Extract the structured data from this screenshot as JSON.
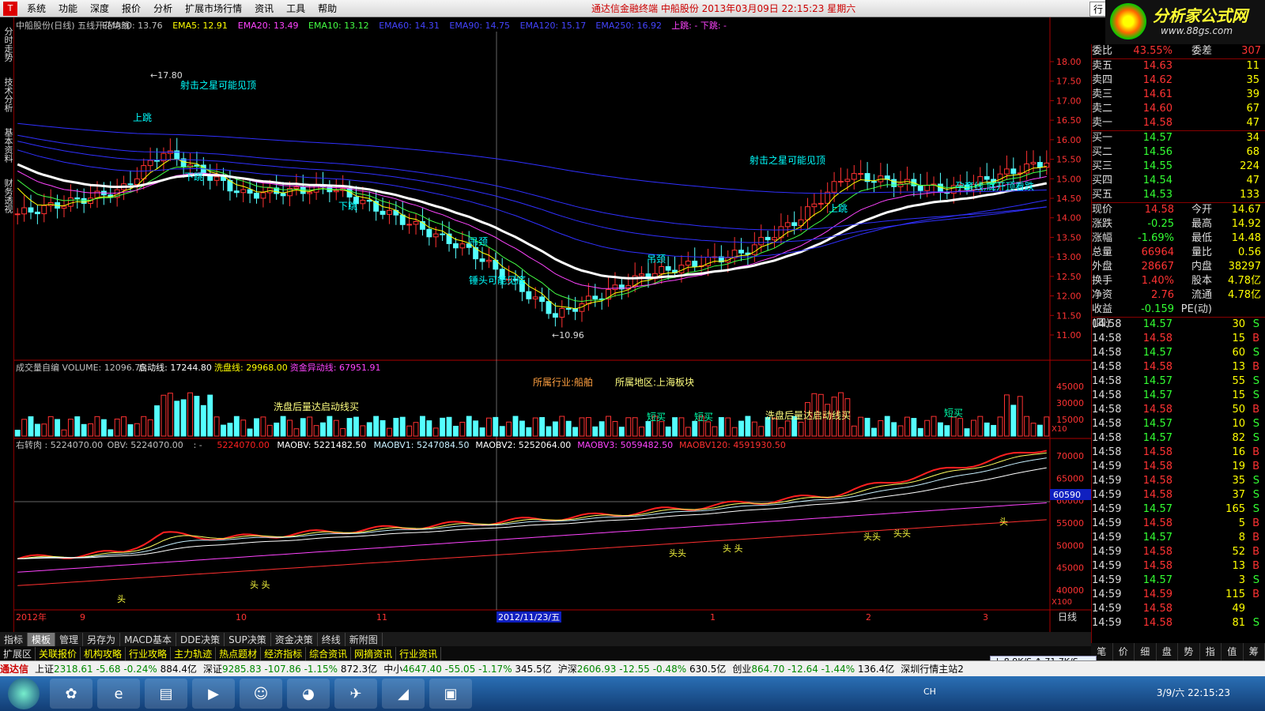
{
  "menu": {
    "items": [
      "系统",
      "功能",
      "深度",
      "报价",
      "分析",
      "扩展市场行情",
      "资讯",
      "工具",
      "帮助"
    ],
    "title": "通达信金融终端   中船股份  2013年03月09日  22:15:23  星期六",
    "tab": "行"
  },
  "brand": {
    "name": "分析家公式网",
    "url": "www.88gs.com"
  },
  "left_tabs": [
    "分时走势",
    "技术分析",
    "基本资料",
    "财务透视"
  ],
  "main_chart": {
    "header_items": [
      {
        "text": "中船股份(日线) 五线开花均线",
        "color": "#c0c0c0"
      },
      {
        "text": "EMA30: 13.76",
        "color": "#c0c0c0"
      },
      {
        "text": "EMA5: 12.91",
        "color": "#ffff00"
      },
      {
        "text": "EMA20: 13.49",
        "color": "#ff44ff"
      },
      {
        "text": "EMA10: 13.12",
        "color": "#44ff44"
      },
      {
        "text": "EMA60: 14.31",
        "color": "#4444ff"
      },
      {
        "text": "EMA90: 14.75",
        "color": "#4444ff"
      },
      {
        "text": "EMA120: 15.17",
        "color": "#4444ff"
      },
      {
        "text": "EMA250: 16.92",
        "color": "#4444ff"
      },
      {
        "text": "上跳: -   下跳: -",
        "color": "#ff44ff"
      }
    ],
    "y_ticks": [
      "18.00",
      "17.50",
      "17.00",
      "16.50",
      "16.00",
      "15.50",
      "15.00",
      "14.50",
      "14.00",
      "13.50",
      "13.00",
      "12.50",
      "12.00",
      "11.50",
      "11.00"
    ],
    "high_label": "17.80",
    "low_label": "10.96",
    "annotations": [
      "射击之星可能见顶",
      "射击之星可能见顶",
      "锤头可能见底",
      "孕育线,底开顶看跌",
      "吊颈",
      "吊颈",
      "上跳",
      "上跳",
      "下跳",
      "下跳"
    ]
  },
  "volume_chart": {
    "header": "成交量自编 VOLUME: 12096.75  启动线: 17244.80  洗盘线: 29968.00  资金异动线: 67951.91",
    "header_items": [
      {
        "text": "成交量自编 VOLUME: 12096.75",
        "color": "#c0c0c0"
      },
      {
        "text": "启动线: 17244.80",
        "color": "#ffffff"
      },
      {
        "text": "洗盘线: 29968.00",
        "color": "#ffff00"
      },
      {
        "text": "资金异动线: 67951.91",
        "color": "#ff44ff"
      }
    ],
    "industry": "所属行业:船舶",
    "region": "所属地区:上海板块",
    "y_ticks": [
      "45000",
      "30000",
      "15000"
    ],
    "unit": "X10",
    "annotations": [
      "洗盘后量达启动线买",
      "洗盘后量达启动线买",
      "短买",
      "短买",
      "短买"
    ]
  },
  "obv_chart": {
    "header_items": [
      {
        "text": "右转肉 : 5224070.00",
        "color": "#c0c0c0"
      },
      {
        "text": "OBV: 5224070.00",
        "color": "#c0c0c0"
      },
      {
        "text": ": -",
        "color": "#c0c0c0"
      },
      {
        "text": "5224070.00",
        "color": "#ff2020"
      },
      {
        "text": "MAOBV: 5221482.50",
        "color": "#ffffff"
      },
      {
        "text": "MAOBV1: 5247084.50",
        "color": "#c8f0ff"
      },
      {
        "text": "MAOBV2: 5252064.00",
        "color": "#ffffff"
      },
      {
        "text": "MAOBV3: 5059482.50",
        "color": "#ff44ff"
      },
      {
        "text": "MAOBV120: 4591930.50",
        "color": "#ff3030"
      }
    ],
    "y_ticks": [
      "70000",
      "65000",
      "60000",
      "55000",
      "50000",
      "45000",
      "40000"
    ],
    "cursor_value": "60590",
    "unit": "X100",
    "head_labels": [
      "头",
      "头 头",
      "头头",
      "头 头",
      "头头",
      "头头",
      "头"
    ]
  },
  "x_axis": {
    "labels": [
      "2012年",
      "9",
      "10",
      "11",
      "2012/11/23/五",
      "1",
      "2",
      "3"
    ],
    "right": "日线"
  },
  "bottom_tabs": [
    "指标",
    "模板",
    "管理",
    "另存为",
    "MACD基本",
    "DDE决策",
    "SUP决策",
    "资金决策",
    "终线",
    "新附图"
  ],
  "bottom_tabs2": [
    "扩展区",
    "关联报价",
    "机构攻略",
    "行业攻略",
    "主力轨迹",
    "热点题材",
    "经济指标",
    "综合资讯",
    "网摘资讯",
    "行业资讯"
  ],
  "quote": {
    "weibi": {
      "label1": "委比",
      "val1": "43.55%",
      "label2": "委差",
      "val2": "307"
    },
    "sell": [
      {
        "label": "卖五",
        "price": "14.63",
        "vol": "11"
      },
      {
        "label": "卖四",
        "price": "14.62",
        "vol": "35"
      },
      {
        "label": "卖三",
        "price": "14.61",
        "vol": "39"
      },
      {
        "label": "卖二",
        "price": "14.60",
        "vol": "67"
      },
      {
        "label": "卖一",
        "price": "14.58",
        "vol": "47"
      }
    ],
    "buy": [
      {
        "label": "买一",
        "price": "14.57",
        "vol": "34"
      },
      {
        "label": "买二",
        "price": "14.56",
        "vol": "68"
      },
      {
        "label": "买三",
        "price": "14.55",
        "vol": "224"
      },
      {
        "label": "买四",
        "price": "14.54",
        "vol": "47"
      },
      {
        "label": "买五",
        "price": "14.53",
        "vol": "133"
      }
    ],
    "stats": [
      [
        "现价",
        "14.58",
        "今开",
        "14.67"
      ],
      [
        "涨跌",
        "-0.25",
        "最高",
        "14.92"
      ],
      [
        "涨幅",
        "-1.69%",
        "最低",
        "14.48"
      ],
      [
        "总量",
        "66964",
        "量比",
        "0.56"
      ],
      [
        "外盘",
        "28667",
        "内盘",
        "38297"
      ],
      [
        "换手",
        "1.40%",
        "股本",
        "4.78亿"
      ],
      [
        "净资",
        "2.76",
        "流通",
        "4.78亿"
      ],
      [
        "收益(四)",
        "-0.159",
        "PE(动)",
        ""
      ]
    ],
    "ticks": [
      [
        "14:58",
        "14.57",
        "30",
        "S"
      ],
      [
        "14:58",
        "14.58",
        "15",
        "B"
      ],
      [
        "14:58",
        "14.57",
        "60",
        "S"
      ],
      [
        "14:58",
        "14.58",
        "13",
        "B"
      ],
      [
        "14:58",
        "14.57",
        "55",
        "S"
      ],
      [
        "14:58",
        "14.57",
        "15",
        "S"
      ],
      [
        "14:58",
        "14.58",
        "50",
        "B"
      ],
      [
        "14:58",
        "14.57",
        "10",
        "S"
      ],
      [
        "14:58",
        "14.57",
        "82",
        "S"
      ],
      [
        "14:58",
        "14.58",
        "16",
        "B"
      ],
      [
        "14:59",
        "14.58",
        "19",
        "B"
      ],
      [
        "14:59",
        "14.58",
        "35",
        "S"
      ],
      [
        "14:59",
        "14.58",
        "37",
        "S"
      ],
      [
        "14:59",
        "14.57",
        "165",
        "S"
      ],
      [
        "14:59",
        "14.58",
        "5",
        "B"
      ],
      [
        "14:59",
        "14.57",
        "8",
        "B"
      ],
      [
        "14:59",
        "14.58",
        "52",
        "B"
      ],
      [
        "14:59",
        "14.58",
        "13",
        "B"
      ],
      [
        "14:59",
        "14.57",
        "3",
        "S"
      ],
      [
        "14:59",
        "14.59",
        "115",
        "B"
      ],
      [
        "14:59",
        "14.58",
        "49",
        ""
      ],
      [
        "14:59",
        "14.58",
        "81",
        "S"
      ]
    ],
    "side_tabs": [
      "笔",
      "价",
      "细",
      "盘",
      "势",
      "指",
      "值",
      "筹"
    ]
  },
  "status": {
    "brand": "通达信",
    "indices": [
      {
        "name": "上证",
        "val": "2318.61",
        "chg": "-5.68",
        "pct": "-0.24%",
        "amt": "884.4亿"
      },
      {
        "name": "深证",
        "val": "9285.83",
        "chg": "-107.86",
        "pct": "-1.15%",
        "amt": "872.3亿"
      },
      {
        "name": "中小",
        "val": "4647.40",
        "chg": "-55.05",
        "pct": "-1.17%",
        "amt": "345.5亿"
      },
      {
        "name": "沪深",
        "val": "2606.93",
        "chg": "-12.55",
        "pct": "-0.48%",
        "amt": "630.5亿"
      },
      {
        "name": "创业",
        "val": "864.70",
        "chg": "-12.64",
        "pct": "-1.44%",
        "amt": "136.4亿"
      }
    ],
    "server": "深圳行情主站2",
    "net": "↓ 8.9K/S  ↑ 71.7K/S"
  },
  "taskbar": {
    "clock": "3/9/六 22:15:23",
    "lang": "CH"
  }
}
